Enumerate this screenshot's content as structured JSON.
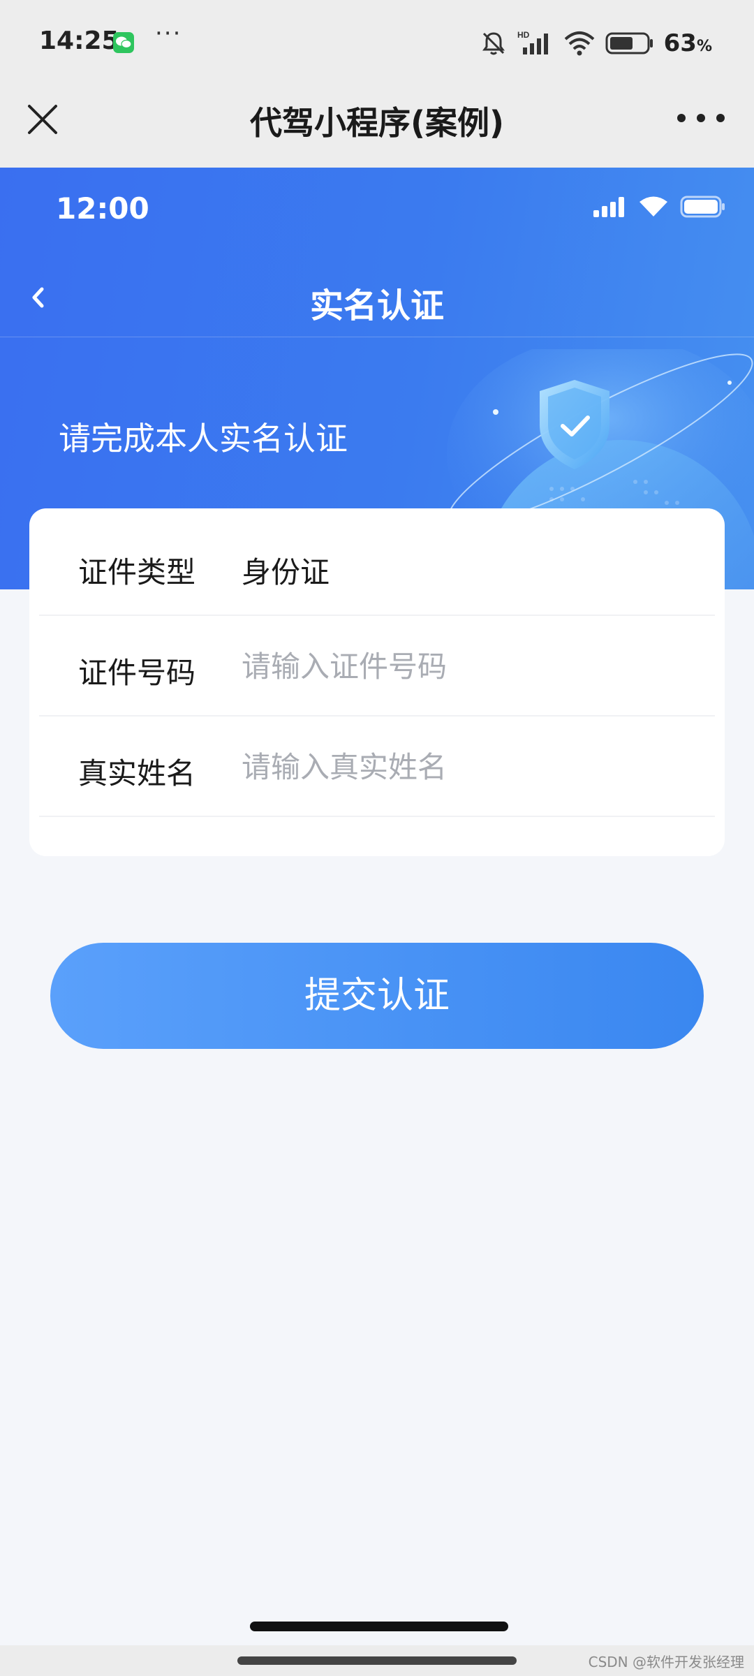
{
  "system_status": {
    "time": "14:25",
    "more": "···",
    "battery_level": "63",
    "battery_unit": "%",
    "battery_fraction": 0.63,
    "icons": [
      "wechat-icon",
      "mute-bell-icon",
      "hd-signal-icon",
      "wifi-icon",
      "battery-icon"
    ]
  },
  "mini_program_nav": {
    "title": "代驾小程序(案例)",
    "close_icon": "close-icon",
    "more_icon": "more-icon"
  },
  "inner_status": {
    "time": "12:00",
    "icons": [
      "signal-icon",
      "wifi-icon",
      "battery-icon"
    ]
  },
  "page": {
    "title": "实名认证",
    "back_icon": "back-chevron-icon",
    "tip": "请完成本人实名认证",
    "illustration": "shield-globe-illustration",
    "accent_color": "#3a78f0"
  },
  "form": {
    "rows": [
      {
        "label": "证件类型",
        "value": "身份证"
      },
      {
        "label": "证件号码",
        "placeholder": "请输入证件号码",
        "value": ""
      },
      {
        "label": "真实姓名",
        "placeholder": "请输入真实姓名",
        "value": ""
      }
    ]
  },
  "submit": {
    "label": "提交认证"
  },
  "watermark": "CSDN @软件开发张经理"
}
